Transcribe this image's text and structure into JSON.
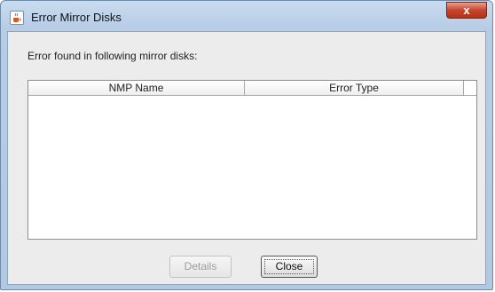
{
  "window": {
    "title": "Error Mirror Disks",
    "title_icon": "java-cup-icon",
    "close_glyph": "x"
  },
  "dialog": {
    "message": "Error found in following mirror disks:",
    "table": {
      "columns": [
        "NMP Name",
        "Error Type"
      ],
      "rows": []
    },
    "buttons": {
      "details": {
        "label": "Details",
        "enabled": false
      },
      "close": {
        "label": "Close",
        "enabled": true,
        "focused": true
      }
    }
  }
}
